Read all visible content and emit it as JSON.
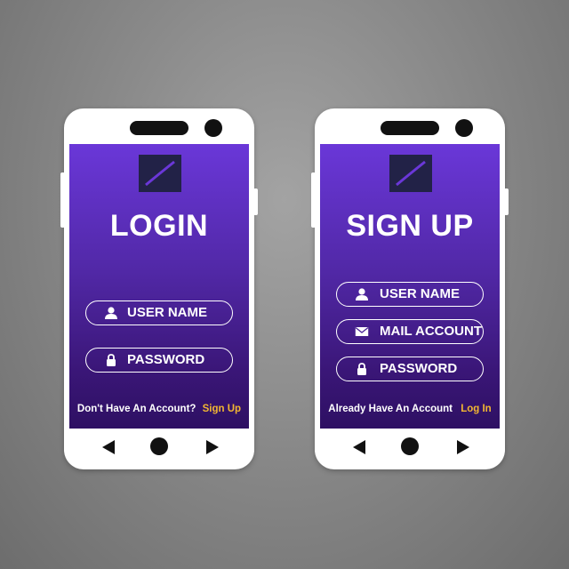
{
  "login": {
    "title": "LOGIN",
    "fields": [
      {
        "label": "USER NAME",
        "icon": "user-icon"
      },
      {
        "label": "PASSWORD",
        "icon": "lock-icon"
      }
    ],
    "footer_text": "Don't Have An Account?",
    "footer_link": "Sign Up"
  },
  "signup": {
    "title": "SIGN UP",
    "fields": [
      {
        "label": "USER NAME",
        "icon": "user-icon"
      },
      {
        "label": "MAIL ACCOUNT",
        "icon": "mail-icon"
      },
      {
        "label": "PASSWORD",
        "icon": "lock-icon"
      }
    ],
    "footer_text": "Already Have An Account",
    "footer_link": "Log In"
  },
  "colors": {
    "screen_top": "#6a37d8",
    "screen_bottom": "#2e1063",
    "link": "#f2b632",
    "logo": "#222247"
  },
  "icons": [
    "logo-icon",
    "user-icon",
    "lock-icon",
    "mail-icon",
    "back-icon",
    "home-icon",
    "forward-icon",
    "camera-icon",
    "speaker-icon"
  ]
}
